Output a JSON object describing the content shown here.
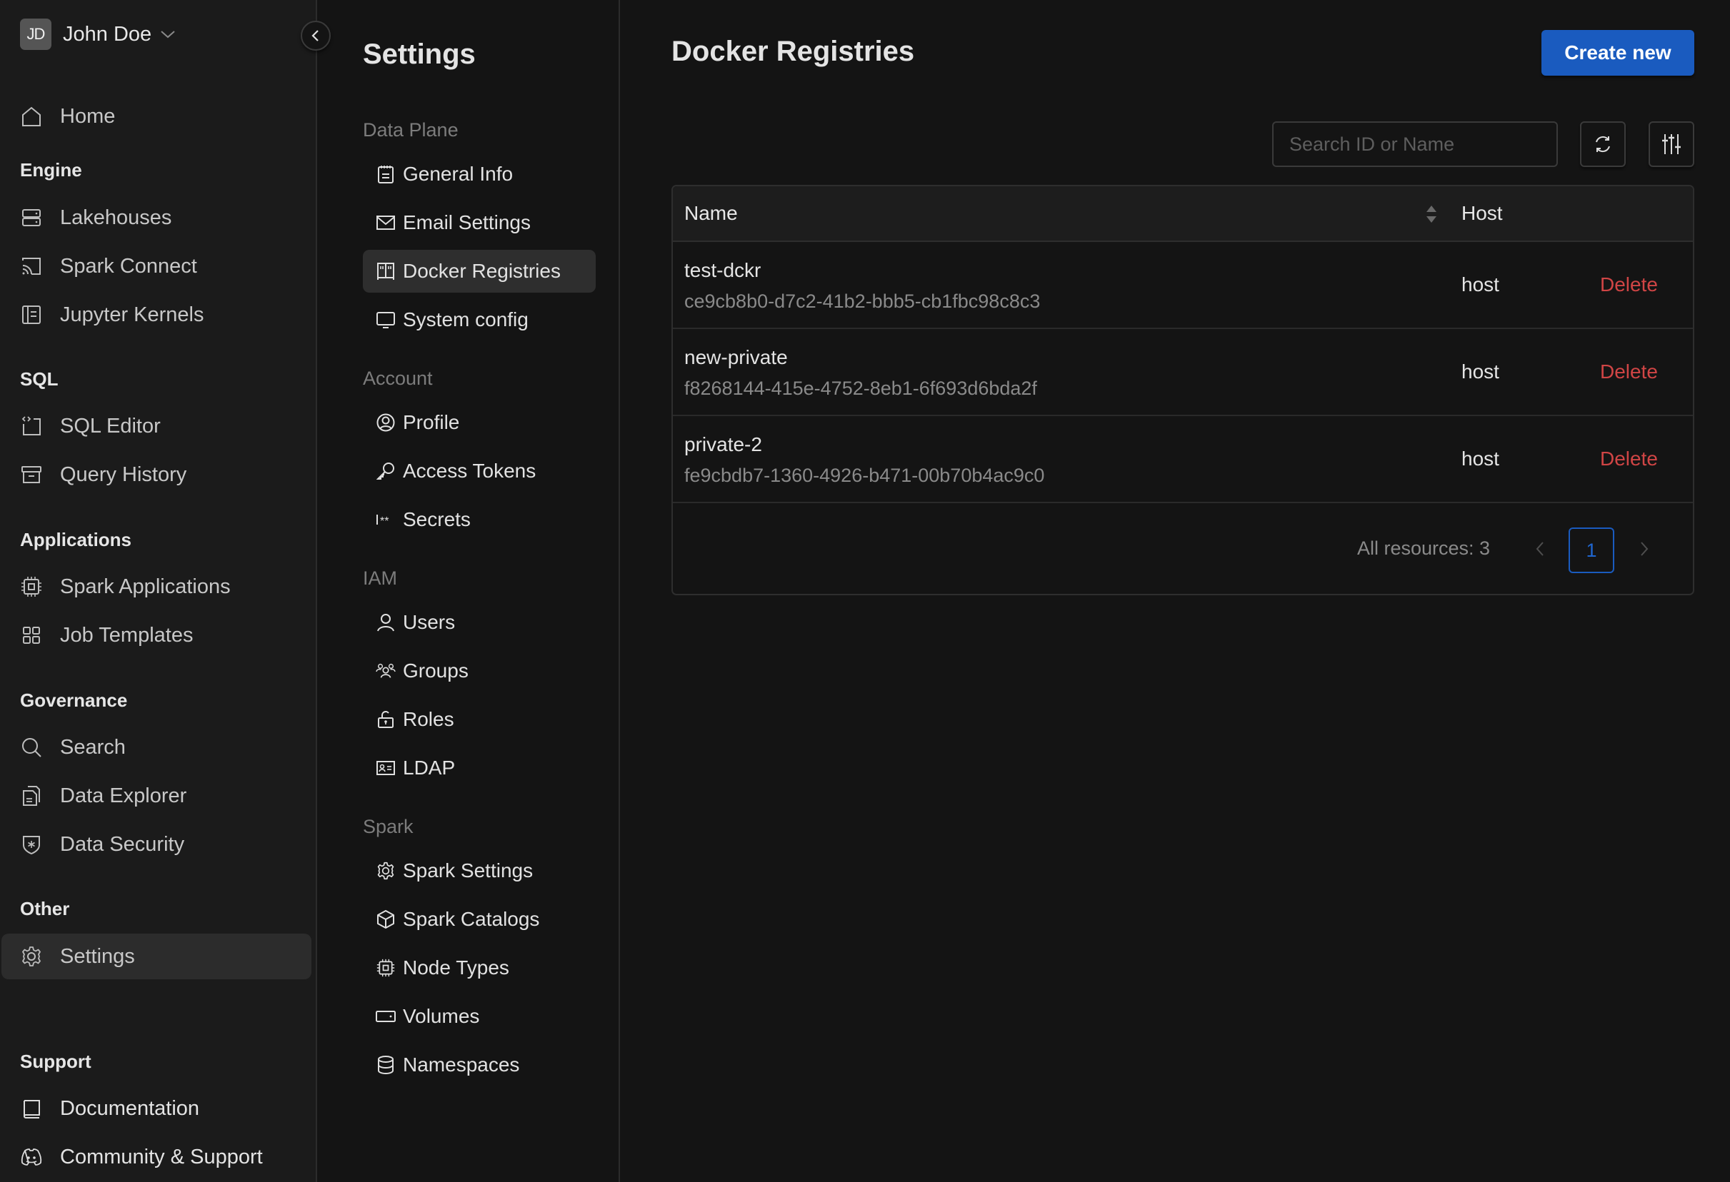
{
  "user": {
    "initials": "JD",
    "name": "John Doe"
  },
  "sidebar": {
    "home": "Home",
    "sections": {
      "engine": "Engine",
      "sql": "SQL",
      "applications": "Applications",
      "governance": "Governance",
      "other": "Other",
      "support": "Support"
    },
    "items": {
      "lakehouses": "Lakehouses",
      "spark_connect": "Spark Connect",
      "jupyter_kernels": "Jupyter Kernels",
      "sql_editor": "SQL Editor",
      "query_history": "Query History",
      "spark_applications": "Spark Applications",
      "job_templates": "Job Templates",
      "search": "Search",
      "data_explorer": "Data Explorer",
      "data_security": "Data Security",
      "settings": "Settings",
      "documentation": "Documentation",
      "community": "Community & Support"
    },
    "active": "Settings"
  },
  "settings_nav": {
    "title": "Settings",
    "sections": {
      "data_plane": "Data Plane",
      "account": "Account",
      "iam": "IAM",
      "spark": "Spark"
    },
    "items": {
      "general_info": "General Info",
      "email_settings": "Email Settings",
      "docker_registries": "Docker Registries",
      "system_config": "System config",
      "profile": "Profile",
      "access_tokens": "Access Tokens",
      "secrets": "Secrets",
      "users": "Users",
      "groups": "Groups",
      "roles": "Roles",
      "ldap": "LDAP",
      "spark_settings": "Spark Settings",
      "spark_catalogs": "Spark Catalogs",
      "node_types": "Node Types",
      "volumes": "Volumes",
      "namespaces": "Namespaces"
    },
    "active": "Docker Registries"
  },
  "main": {
    "title": "Docker Registries",
    "create_label": "Create new",
    "search": {
      "placeholder": "Search ID or Name",
      "value": ""
    },
    "table": {
      "columns": [
        "Name",
        "Host"
      ],
      "rows": [
        {
          "name": "test-dckr",
          "id": "ce9cb8b0-d7c2-41b2-bbb5-cb1fbc98c8c3",
          "host": "host",
          "action": "Delete"
        },
        {
          "name": "new-private",
          "id": "f8268144-415e-4752-8eb1-6f693d6bda2f",
          "host": "host",
          "action": "Delete"
        },
        {
          "name": "private-2",
          "id": "fe9cbdb7-1360-4926-b471-00b70b4ac9c0",
          "host": "host",
          "action": "Delete"
        }
      ]
    },
    "pagination": {
      "total_label": "All resources: 3",
      "current_page": "1"
    }
  },
  "colors": {
    "accent": "#1a5bbf",
    "danger": "#d04545",
    "sidebar_bg": "#1b1b1b",
    "page_bg": "#141414"
  }
}
